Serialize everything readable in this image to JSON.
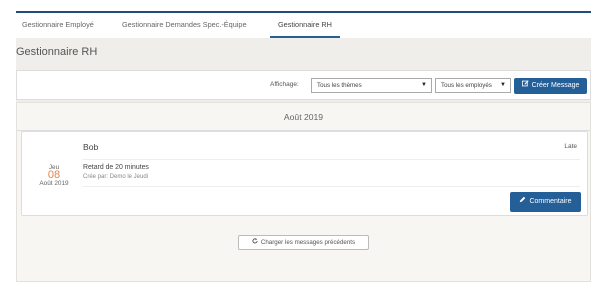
{
  "tabs": [
    {
      "label": "Gestionnaire Employé"
    },
    {
      "label": "Gestionnaire Demandes Spec.-Équipe"
    },
    {
      "label": "Gestionnaire RH"
    }
  ],
  "panel": {
    "title": "Gestionnaire RH"
  },
  "filters": {
    "label": "Affichage:",
    "theme_select": {
      "value": "Tous les thèmes"
    },
    "employee_select": {
      "value": "Tous les employés"
    },
    "create_button": {
      "label": "Créer Message",
      "icon": "edit-icon"
    }
  },
  "feed": {
    "month_header": "Août 2019",
    "messages": [
      {
        "author": "Bob",
        "badge": "Late",
        "date": {
          "weekday": "Jeu",
          "day": "08",
          "month_year": "Août 2019"
        },
        "text": "Retard de 20 minutes",
        "created_by": "Crée par: Demo le Jeudi",
        "comment_button": {
          "label": "Commentaire",
          "icon": "pencil-icon"
        }
      }
    ],
    "load_more": {
      "label": "Charger les messages précédents",
      "icon": "refresh-icon"
    }
  },
  "colors": {
    "primary": "#245f98",
    "accent_date": "#e0864a",
    "panel_bg": "#f0eeea"
  }
}
